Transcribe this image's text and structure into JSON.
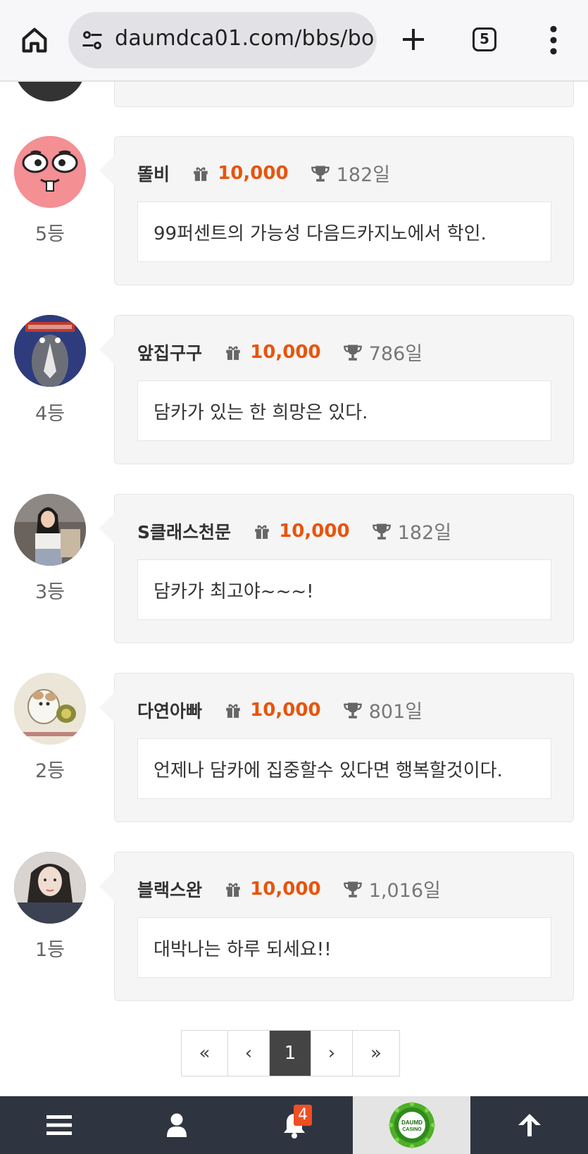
{
  "browser": {
    "url": "daumdca01.com/bbs/bo",
    "tab_count": "5"
  },
  "comments": [
    {
      "nick": "똘비",
      "points": "10,000",
      "days": "182일",
      "message": "99퍼센트의 가능성 다음드카지노에서 학인.",
      "rank": "5등"
    },
    {
      "nick": "앞집구구",
      "points": "10,000",
      "days": "786일",
      "message": "담카가 있는 한 희망은 있다.",
      "rank": "4등"
    },
    {
      "nick": "S클래스천문",
      "points": "10,000",
      "days": "182일",
      "message": "담카가 최고야~~~!",
      "rank": "3등"
    },
    {
      "nick": "다연아빠",
      "points": "10,000",
      "days": "801일",
      "message": "언제나 담카에 집중할수 있다면 행복할것이다.",
      "rank": "2등"
    },
    {
      "nick": "블랙스완",
      "points": "10,000",
      "days": "1,016일",
      "message": "대박나는 하루 되세요!!",
      "rank": "1등"
    }
  ],
  "pagination": {
    "first": "«",
    "prev": "‹",
    "current": "1",
    "next": "›",
    "last": "»"
  },
  "bottom_nav": {
    "notification_count": "4",
    "logo_text_line1": "DAUMD",
    "logo_text_line2": "CASINO"
  },
  "colors": {
    "points": "#e8540c",
    "nav_bg": "#2e3540",
    "badge": "#f04e23"
  }
}
